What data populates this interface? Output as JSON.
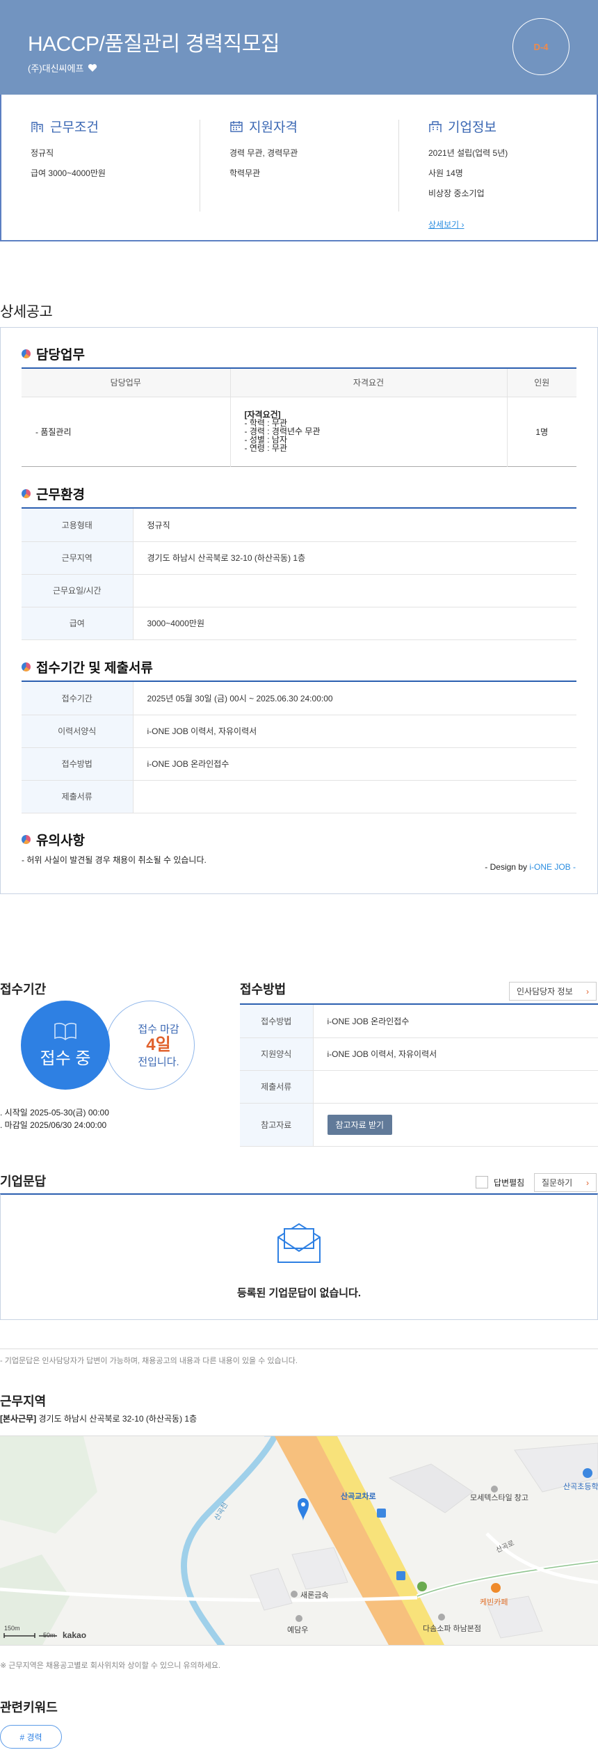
{
  "header": {
    "title": "HACCP/품질관리 경력직모집",
    "company": "(주)대신씨에프",
    "dday": "D-4"
  },
  "summary": {
    "conditions": {
      "title": "근무조건",
      "items": [
        "정규직",
        "급여 3000~4000만원"
      ]
    },
    "qualifications": {
      "title": "지원자격",
      "items": [
        "경력 무관, 경력무관",
        "학력무관"
      ]
    },
    "company_info": {
      "title": "기업정보",
      "items": [
        "2021년 설립(업력 5년)",
        "사원 14명",
        "비상장 중소기업"
      ],
      "more": "상세보기"
    }
  },
  "detail": {
    "section_title": "상세공고",
    "duty": {
      "title": "담당업무",
      "headers": [
        "담당업무",
        "자격요건",
        "인원"
      ],
      "row": {
        "duty": "- 품질관리",
        "req_title": "[자격요건]",
        "req_lines": [
          "- 학력 : 무관",
          "- 경력 : 경력년수 무관",
          "- 성별 : 남자",
          "- 연령 : 무관"
        ],
        "count": "1명"
      }
    },
    "environment": {
      "title": "근무환경",
      "rows": [
        {
          "label": "고용형태",
          "value": "정규직"
        },
        {
          "label": "근무지역",
          "value": "경기도 하남시 산곡북로 32-10 (하산곡동) 1층"
        },
        {
          "label": "근무요일/시간",
          "value": ""
        },
        {
          "label": "급여",
          "value": "3000~4000만원"
        }
      ]
    },
    "application": {
      "title": "접수기간 및 제출서류",
      "rows": [
        {
          "label": "접수기간",
          "value": "2025년 05월 30일 (금) 00시 ~ 2025.06.30 24:00:00"
        },
        {
          "label": "이력서양식",
          "value": "i-ONE JOB 이력서, 자유이력서"
        },
        {
          "label": "접수방법",
          "value": "i-ONE JOB 온라인접수"
        },
        {
          "label": "제출서류",
          "value": ""
        }
      ]
    },
    "notice": {
      "title": "유의사항",
      "text": "- 허위 사실이 발견될 경우 채용이 취소될 수 있습니다.",
      "design_prefix": "- Design by ",
      "design_brand": "i-ONE JOB -"
    }
  },
  "period": {
    "title": "접수기간",
    "status": "접수 중",
    "deadline_label": "접수 마감",
    "days_left": "4일",
    "days_suffix": "전입니다.",
    "start": "시작일 2025-05-30(금) 00:00",
    "end": "마감일 2025/06/30 24:00:00"
  },
  "method": {
    "title": "접수방법",
    "hr_button": "인사담당자 정보",
    "rows": [
      {
        "label": "접수방법",
        "value": "i-ONE JOB 온라인접수"
      },
      {
        "label": "지원양식",
        "value": "i-ONE JOB 이력서, 자유이력서"
      },
      {
        "label": "제출서류",
        "value": ""
      },
      {
        "label": "참고자료",
        "value": ""
      }
    ],
    "ref_button": "참고자료 받기"
  },
  "qna": {
    "title": "기업문답",
    "edit_label": "답변펼침",
    "ask_button": "질문하기",
    "empty": "등록된 기업문답이 없습니다.",
    "note": "- 기업문답은 인사담당자가 답변이 가능하며, 채용공고의 내용과 다른 내용이 있을 수 있습니다."
  },
  "location": {
    "title": "근무지역",
    "tag": "[본사근무]",
    "address": "경기도 하남시 산곡북로 32-10 (하산곡동) 1층",
    "map_labels": [
      "산곡교차로",
      "모세텍스타일 창고",
      "산곡초등학",
      "새론금속",
      "예담우",
      "다솜소파 하남본점",
      "케빈카페",
      "산곡천",
      "산곡로"
    ],
    "scale": "50m",
    "scale_small": "150m",
    "brand": "kakao",
    "note": "※ 근무지역은 채용공고별로 회사위치와 상이할 수 있으니 유의하세요."
  },
  "keywords": {
    "title": "관련키워드",
    "items": [
      "# 경력"
    ]
  },
  "colors": {
    "header_bg": "#7294c0",
    "accent": "#2e80e3",
    "orange": "#e0602b",
    "dday": "#f08a4b"
  }
}
